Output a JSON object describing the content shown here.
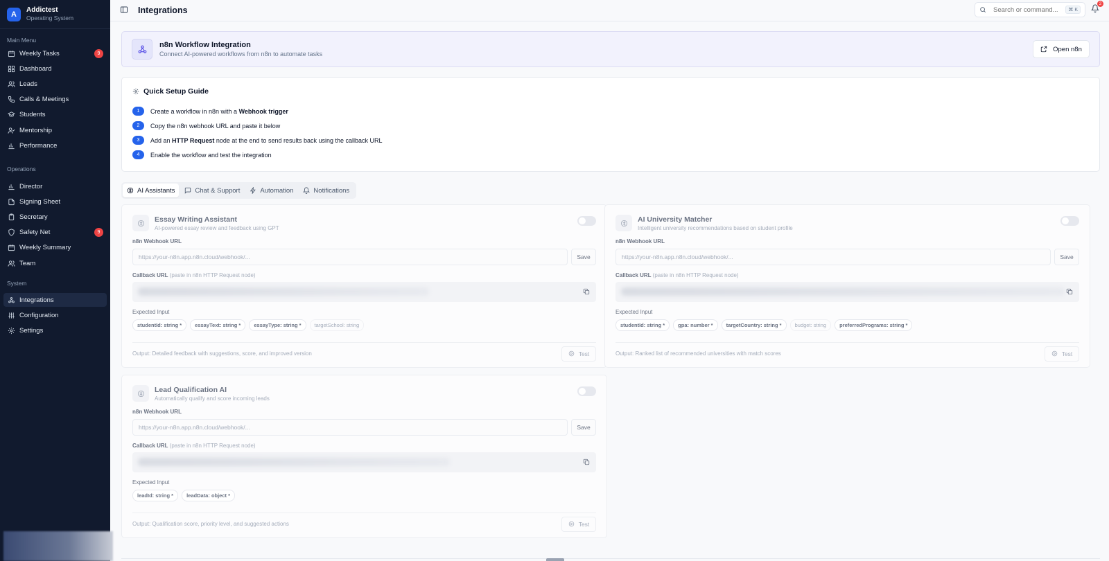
{
  "brand": {
    "initial": "A",
    "name": "Addictest",
    "subtitle": "Operating System"
  },
  "sidebar": {
    "main_label": "Main Menu",
    "main_items": [
      {
        "label": "Weekly Tasks",
        "icon": "calendar-icon",
        "badge": "9"
      },
      {
        "label": "Dashboard",
        "icon": "grid-icon"
      },
      {
        "label": "Leads",
        "icon": "users-icon"
      },
      {
        "label": "Calls & Meetings",
        "icon": "phone-icon"
      },
      {
        "label": "Students",
        "icon": "graduation-cap-icon"
      },
      {
        "label": "Mentorship",
        "icon": "user-check-icon"
      },
      {
        "label": "Performance",
        "icon": "bar-chart-icon"
      }
    ],
    "ops_label": "Operations",
    "ops_items": [
      {
        "label": "Director",
        "icon": "bar-chart-icon"
      },
      {
        "label": "Signing Sheet",
        "icon": "file-icon"
      },
      {
        "label": "Secretary",
        "icon": "clipboard-icon"
      },
      {
        "label": "Safety Net",
        "icon": "shield-icon",
        "badge": "9"
      },
      {
        "label": "Weekly Summary",
        "icon": "calendar-icon"
      },
      {
        "label": "Team",
        "icon": "users-icon"
      }
    ],
    "system_label": "System",
    "system_items": [
      {
        "label": "Integrations",
        "icon": "webhook-icon",
        "active": true
      },
      {
        "label": "Configuration",
        "icon": "sliders-icon"
      },
      {
        "label": "Settings",
        "icon": "gear-icon"
      }
    ]
  },
  "header": {
    "title": "Integrations",
    "search_placeholder": "Search or command...",
    "shortcut": "⌘ K",
    "notifications": "2"
  },
  "banner": {
    "title": "n8n Workflow Integration",
    "subtitle": "Connect AI-powered workflows from n8n to automate tasks",
    "button": "Open n8n"
  },
  "guide": {
    "title": "Quick Setup Guide",
    "steps": [
      {
        "num": "1",
        "pre": "Create a workflow in n8n with a ",
        "bold": "Webhook trigger",
        "post": ""
      },
      {
        "num": "2",
        "pre": "Copy the n8n webhook URL and paste it below",
        "bold": "",
        "post": ""
      },
      {
        "num": "3",
        "pre": "Add an ",
        "bold": "HTTP Request",
        "post": " node at the end to send results back using the callback URL"
      },
      {
        "num": "4",
        "pre": "Enable the workflow and test the integration",
        "bold": "",
        "post": ""
      }
    ]
  },
  "tabs": [
    {
      "label": "AI Assistants",
      "icon": "brain-icon",
      "active": true
    },
    {
      "label": "Chat & Support",
      "icon": "message-icon"
    },
    {
      "label": "Automation",
      "icon": "zap-icon"
    },
    {
      "label": "Notifications",
      "icon": "bell-icon"
    }
  ],
  "common": {
    "webhook_label": "n8n Webhook URL",
    "webhook_placeholder": "https://your-n8n.app.n8n.cloud/webhook/...",
    "save": "Save",
    "callback_label": "Callback URL",
    "callback_hint": "(paste in n8n HTTP Request node)",
    "expected_label": "Expected Input",
    "test": "Test"
  },
  "cards": [
    {
      "title": "Essay Writing Assistant",
      "desc": "AI-powered essay review and feedback using GPT",
      "chips": [
        {
          "text": "studentId: string *",
          "required": true
        },
        {
          "text": "essayText: string *",
          "required": true
        },
        {
          "text": "essayType: string *",
          "required": true
        },
        {
          "text": "targetSchool: string",
          "required": false
        }
      ],
      "output": "Output: Detailed feedback with suggestions, score, and improved version"
    },
    {
      "title": "AI University Matcher",
      "desc": "Intelligent university recommendations based on student profile",
      "chips": [
        {
          "text": "studentId: string *",
          "required": true
        },
        {
          "text": "gpa: number *",
          "required": true
        },
        {
          "text": "targetCountry: string *",
          "required": true
        },
        {
          "text": "budget: string",
          "required": false
        },
        {
          "text": "preferredPrograms: string *",
          "required": true
        }
      ],
      "output": "Output: Ranked list of recommended universities with match scores"
    },
    {
      "title": "Lead Qualification AI",
      "desc": "Automatically qualify and score incoming leads",
      "chips": [
        {
          "text": "leadId: string *",
          "required": true
        },
        {
          "text": "leadData: object *",
          "required": true
        }
      ],
      "output": "Output: Qualification score, priority level, and suggested actions"
    }
  ]
}
